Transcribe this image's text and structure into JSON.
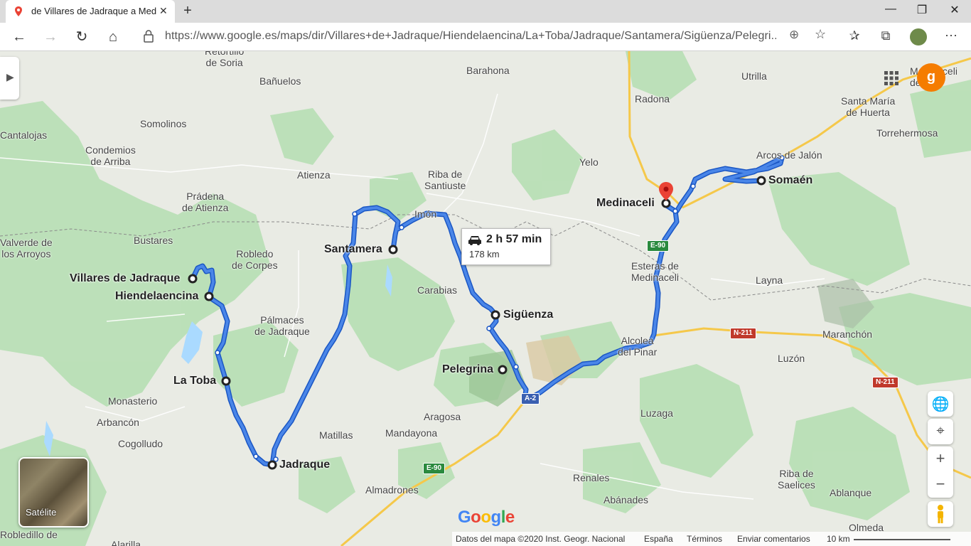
{
  "browser": {
    "tab_title": "de Villares de Jadraque a Medinaceli",
    "new_tab_label": "+",
    "url": "https://www.google.es/maps/dir/Villares+de+Jadraque/Hiendelaencina/La+Toba/Jadraque/Santamera/Sigüenza/Pelegri...",
    "controls": {
      "minimize": "—",
      "restore": "❐",
      "close": "✕"
    }
  },
  "map": {
    "places": [
      {
        "name": "Retortillo\nde Soria"
      },
      {
        "name": "Bañuelos"
      },
      {
        "name": "Barahona"
      },
      {
        "name": "Utrilla"
      },
      {
        "name": "Radona"
      },
      {
        "name": "Santa María\nde Huerta"
      },
      {
        "name": "Torrehermosa"
      },
      {
        "name": "Somolinos"
      },
      {
        "name": "Cantalojas"
      },
      {
        "name": "Condemios\nde Arriba"
      },
      {
        "name": "Atienza"
      },
      {
        "name": "Riba de\nSantiuste"
      },
      {
        "name": "Yelo"
      },
      {
        "name": "Arcos de Jalón"
      },
      {
        "name": "Prádena\nde Atienza"
      },
      {
        "name": "Imón"
      },
      {
        "name": "Bustares"
      },
      {
        "name": "Valverde de\nlos Arroyos"
      },
      {
        "name": "Robledo\nde Corpes"
      },
      {
        "name": "Esteras de\nMedinaceli"
      },
      {
        "name": "Layna"
      },
      {
        "name": "Carabias"
      },
      {
        "name": "Pálmaces\nde Jadraque"
      },
      {
        "name": "Alcolea\ndel Pinar"
      },
      {
        "name": "Maranchón"
      },
      {
        "name": "Luzón"
      },
      {
        "name": "Monasterio"
      },
      {
        "name": "Arbancón"
      },
      {
        "name": "Cogolludo"
      },
      {
        "name": "Aragosa"
      },
      {
        "name": "Matillas"
      },
      {
        "name": "Mandayona"
      },
      {
        "name": "Luzaga"
      },
      {
        "name": "Renales"
      },
      {
        "name": "Riba de\nSaelices"
      },
      {
        "name": "Ablanque"
      },
      {
        "name": "Almadrones"
      },
      {
        "name": "Abánades"
      },
      {
        "name": "Olmeda"
      },
      {
        "name": "Robledillo de"
      },
      {
        "name": "Alarilla"
      },
      {
        "name": "Medinaceli\nde..."
      }
    ],
    "waypoints": [
      {
        "name": "Villares de Jadraque"
      },
      {
        "name": "Hiendelaencina"
      },
      {
        "name": "La Toba"
      },
      {
        "name": "Jadraque"
      },
      {
        "name": "Santamera"
      },
      {
        "name": "Sigüenza"
      },
      {
        "name": "Pelegrina"
      },
      {
        "name": "Medinaceli"
      },
      {
        "name": "Somaén"
      }
    ],
    "road_shields": [
      {
        "label": "E-90",
        "color": "green"
      },
      {
        "label": "E-90",
        "color": "green"
      },
      {
        "label": "N-211",
        "color": "red"
      },
      {
        "label": "N-211",
        "color": "red"
      },
      {
        "label": "A-2",
        "color": "blue"
      }
    ],
    "route_callout": {
      "time": "2 h 57 min",
      "distance": "178 km"
    },
    "satellite_label": "Satélite",
    "avatar_letter": "g",
    "google_logo": "Google",
    "footer": {
      "data": "Datos del mapa ©2020 Inst. Geogr. Nacional",
      "country": "España",
      "terms": "Términos",
      "feedback": "Enviar comentarios",
      "scale": "10 km"
    },
    "colors": {
      "route": "#4a86e8",
      "water": "#aadaff",
      "forest": "#b7dfb4",
      "highway": "#f5c84a"
    }
  }
}
